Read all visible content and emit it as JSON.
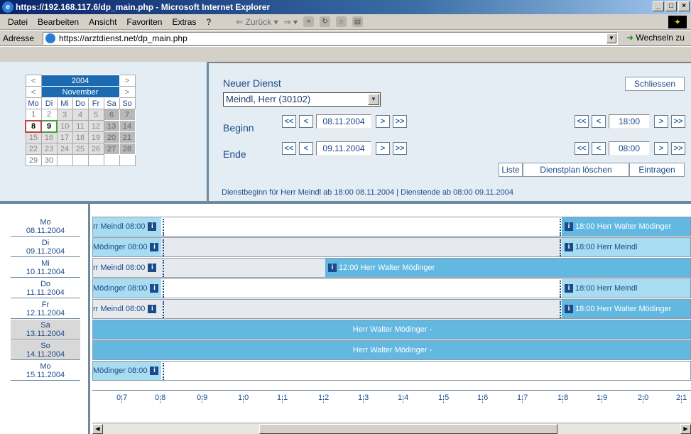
{
  "window": {
    "title": "https://192.168.117.6/dp_main.php - Microsoft Internet Explorer"
  },
  "menu": {
    "items": [
      "Datei",
      "Bearbeiten",
      "Ansicht",
      "Favoriten",
      "Extras",
      "?"
    ],
    "back": "Zurück"
  },
  "address": {
    "label": "Adresse",
    "url": "https://arztdienst.net/dp_main.php",
    "go": "Wechseln zu"
  },
  "calendar": {
    "year": "2004",
    "month": "November",
    "weekdays": [
      "Mo",
      "Di",
      "Mi",
      "Do",
      "Fr",
      "Sa",
      "So"
    ],
    "weeks": [
      [
        "1",
        "2",
        "3",
        "4",
        "5",
        "6",
        "7"
      ],
      [
        "8",
        "9",
        "10",
        "11",
        "12",
        "13",
        "14"
      ],
      [
        "15",
        "16",
        "17",
        "18",
        "19",
        "20",
        "21"
      ],
      [
        "22",
        "23",
        "24",
        "25",
        "26",
        "27",
        "28"
      ],
      [
        "29",
        "30",
        "",
        "",
        "",
        "",
        ""
      ]
    ]
  },
  "form": {
    "title": "Neuer Dienst",
    "close": "Schliessen",
    "person": "Meindl, Herr (30102)",
    "begin_label": "Beginn",
    "end_label": "Ende",
    "begin_date": "08.11.2004",
    "end_date": "09.11.2004",
    "begin_time": "18:00",
    "end_time": "08:00",
    "btn_first": "<<",
    "btn_prev": "<",
    "btn_next": ">",
    "btn_last": ">>",
    "list": "Liste",
    "delete": "Dienstplan löschen",
    "enter": "Eintragen",
    "info": "Dienstbeginn für Herr Meindl ab 18:00 08.11.2004 | Dienstende ab 08:00 09.11.2004"
  },
  "days": [
    {
      "dow": "Mo",
      "date": "08.11.2004"
    },
    {
      "dow": "Di",
      "date": "09.11.2004"
    },
    {
      "dow": "Mi",
      "date": "10.11.2004"
    },
    {
      "dow": "Do",
      "date": "11.11.2004"
    },
    {
      "dow": "Fr",
      "date": "12.11.2004"
    },
    {
      "dow": "Sa",
      "date": "13.11.2004"
    },
    {
      "dow": "So",
      "date": "14.11.2004"
    },
    {
      "dow": "Mo",
      "date": "15.11.2004"
    }
  ],
  "rows": [
    {
      "left": "rr Meindl 08:00",
      "right": "18:00 Herr Walter Mödinger"
    },
    {
      "left": "Mödinger 08:00",
      "right": "18:00 Herr Meindl"
    },
    {
      "left": "rr Meindl 08:00",
      "mid": "12:00 Herr Walter Mödinger"
    },
    {
      "left": "Mödinger 08:00",
      "right": "18:00 Herr Meindl"
    },
    {
      "left": "rr Meindl 08:00",
      "right": "18:00 Herr Walter Mödinger"
    },
    {
      "full": "Herr Walter Mödinger -"
    },
    {
      "full": "Herr Walter Mödinger -"
    },
    {
      "left": "Mödinger 08:00"
    }
  ],
  "info_icon": "i",
  "axis_ticks": [
    "0:7",
    "0:8",
    "0:9",
    "1:0",
    "1:1",
    "1:2",
    "1:3",
    "1:4",
    "1:5",
    "1:6",
    "1:7",
    "1:8",
    "1:9",
    "2:0",
    "2:1"
  ]
}
